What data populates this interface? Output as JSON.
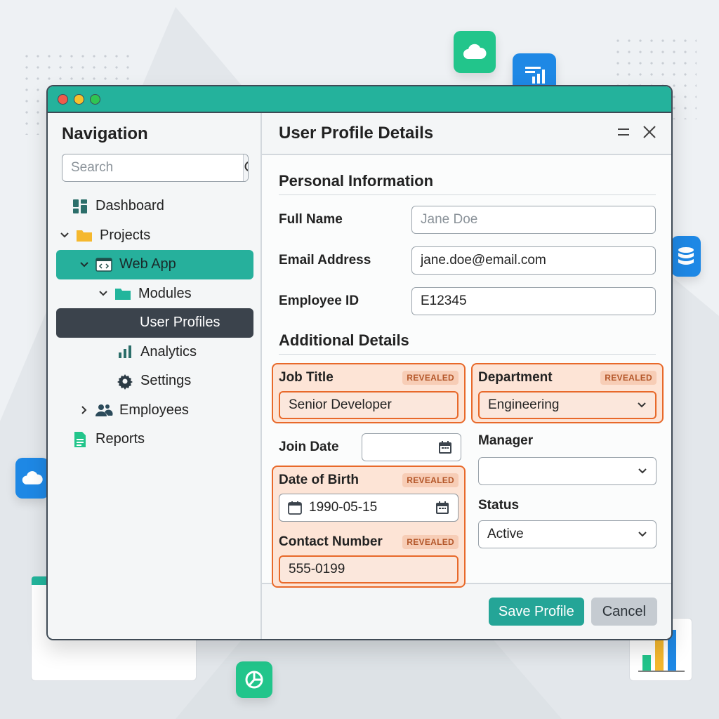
{
  "colors": {
    "accent": "#24b29c",
    "selected_dark": "#3b434c",
    "revealed_border": "#e8692a",
    "revealed_bg": "#fde4d6"
  },
  "sidebar": {
    "title": "Navigation",
    "search_placeholder": "Search",
    "items": [
      {
        "label": "Dashboard",
        "icon": "dashboard-icon",
        "level": 0
      },
      {
        "label": "Projects",
        "icon": "folder-icon",
        "level": 0,
        "expanded": true
      },
      {
        "label": "Web App",
        "icon": "code-window-icon",
        "level": 1,
        "expanded": true,
        "state": "selected-parent"
      },
      {
        "label": "Modules",
        "icon": "folder-icon",
        "level": 2,
        "expanded": true
      },
      {
        "label": "User Profiles",
        "icon": "",
        "level": 3,
        "state": "selected"
      },
      {
        "label": "Analytics",
        "icon": "bar-chart-icon",
        "level": 3
      },
      {
        "label": "Settings",
        "icon": "gear-icon",
        "level": 3
      },
      {
        "label": "Employees",
        "icon": "users-icon",
        "level": 1,
        "expanded": false
      },
      {
        "label": "Reports",
        "icon": "document-icon",
        "level": 0
      }
    ]
  },
  "main": {
    "title": "User Profile Details",
    "personal": {
      "title": "Personal Information",
      "full_name": {
        "label": "Full Name",
        "placeholder": "Jane Doe"
      },
      "email": {
        "label": "Email Address",
        "value": "jane.doe@email.com"
      },
      "employee_id": {
        "label": "Employee ID",
        "value": "E12345"
      }
    },
    "additional": {
      "title": "Additional Details",
      "badge": "REVEALED",
      "job_title": {
        "label": "Job Title",
        "value": "Senior Developer"
      },
      "department": {
        "label": "Department",
        "value": "Engineering"
      },
      "join_date": {
        "label": "Join Date",
        "value": ""
      },
      "manager": {
        "label": "Manager",
        "value": ""
      },
      "dob": {
        "label": "Date of Birth",
        "value": "1990-05-15"
      },
      "status": {
        "label": "Status",
        "value": "Active"
      },
      "contact": {
        "label": "Contact Number",
        "value": "555-0199"
      }
    },
    "buttons": {
      "save": "Save Profile",
      "cancel": "Cancel"
    }
  }
}
